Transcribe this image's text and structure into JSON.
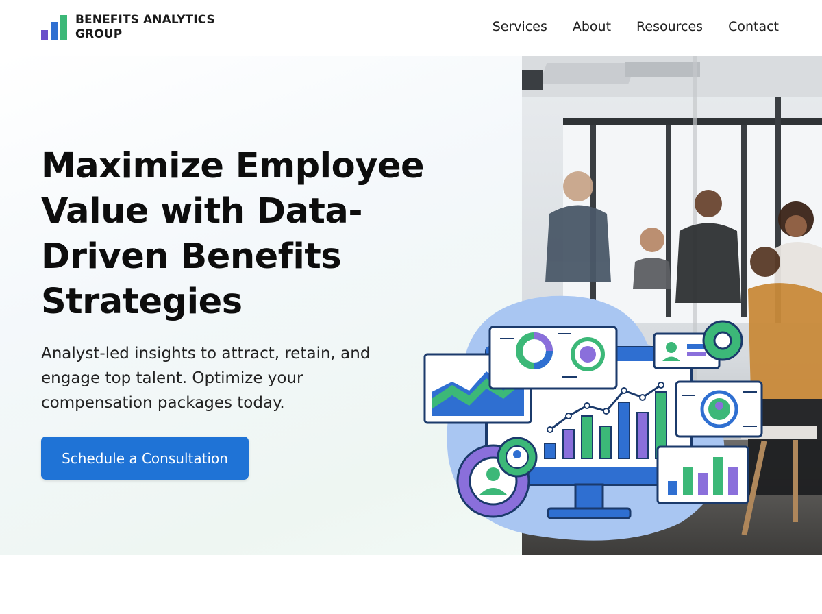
{
  "brand": {
    "name_line1": "BENEFITS ANALYTICS",
    "name_line2": "GROUP",
    "logo_icon": "bar-chart-logo-icon",
    "colors": {
      "bar1": "#6a4fc9",
      "bar2": "#2f6fd1",
      "bar3": "#3cb878"
    }
  },
  "nav": {
    "items": [
      {
        "label": "Services"
      },
      {
        "label": "About"
      },
      {
        "label": "Resources"
      },
      {
        "label": "Contact"
      }
    ]
  },
  "hero": {
    "headline": [
      "Maximize Employee",
      "Value with Data-",
      "Driven Benefits",
      "Strategies"
    ],
    "subheadline": [
      "Analyst-led insights to attract, retain, and",
      "engage top talent. Optimize your",
      "compensation packages today."
    ],
    "cta_label": "Schedule a Consultation",
    "accent_color": "#1f73d6"
  },
  "illustration": {
    "icons": [
      "monitor-icon",
      "area-chart-icon",
      "donut-chart-icon",
      "profile-card-icon",
      "gear-icon",
      "bar-chart-icon",
      "user-icon"
    ]
  }
}
